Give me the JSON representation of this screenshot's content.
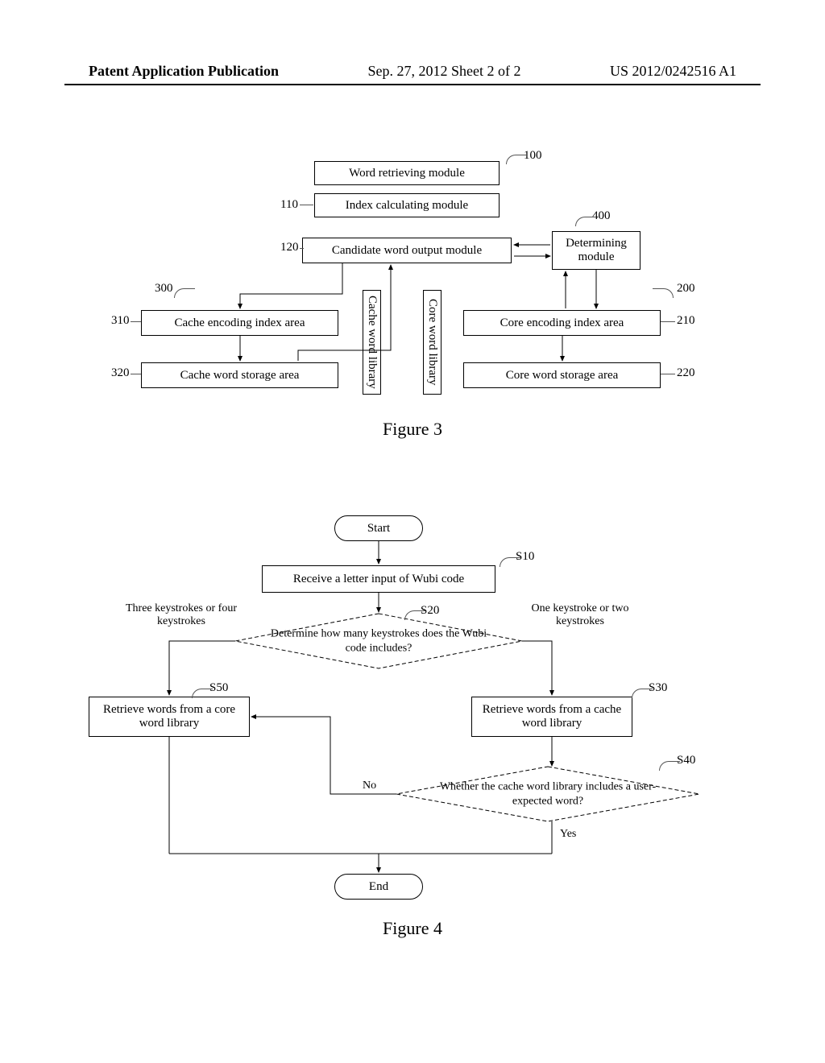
{
  "header": {
    "left": "Patent Application Publication",
    "center": "Sep. 27, 2012  Sheet 2 of 2",
    "right": "US 2012/0242516 A1"
  },
  "fig3": {
    "caption": "Figure 3",
    "blocks": {
      "b100": {
        "ref": "100",
        "text": "Word retrieving module"
      },
      "b110": {
        "ref": "110",
        "text": "Index calculating module"
      },
      "b120": {
        "ref": "120",
        "text": "Candidate word output module"
      },
      "b400": {
        "ref": "400",
        "text": "Determining module"
      },
      "b300": {
        "ref": "300",
        "text": "Cache word library"
      },
      "b310": {
        "ref": "310",
        "text": "Cache encoding index area"
      },
      "b320": {
        "ref": "320",
        "text": "Cache word storage area"
      },
      "b200": {
        "ref": "200",
        "text": "Core word library"
      },
      "b210": {
        "ref": "210",
        "text": "Core encoding index area"
      },
      "b220": {
        "ref": "220",
        "text": "Core word storage area"
      }
    }
  },
  "fig4": {
    "caption": "Figure 4",
    "start": "Start",
    "end": "End",
    "s10": {
      "ref": "S10",
      "text": "Receive a letter input of Wubi code"
    },
    "s20": {
      "ref": "S20",
      "text": "Determine how many keystrokes does the Wubi code includes?"
    },
    "s30": {
      "ref": "S30",
      "text": "Retrieve words from a cache word library"
    },
    "s40": {
      "ref": "S40",
      "text": "Whether the cache word library includes a user-expected word?"
    },
    "s50": {
      "ref": "S50",
      "text": "Retrieve words from a core word library"
    },
    "labels": {
      "left_branch": "Three keystrokes or four keystrokes",
      "right_branch": "One keystroke or two keystrokes",
      "no": "No",
      "yes": "Yes"
    }
  }
}
